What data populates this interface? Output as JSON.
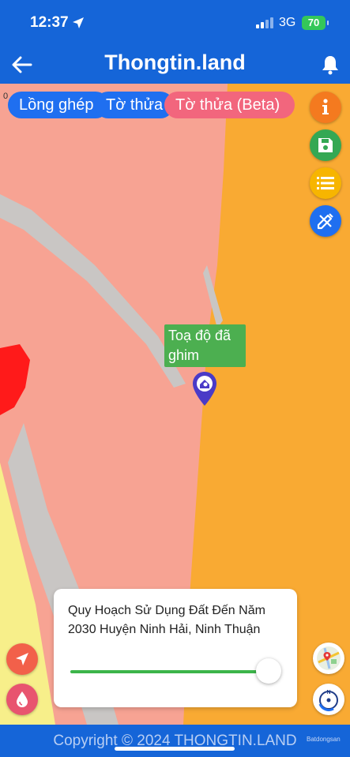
{
  "status_bar": {
    "time": "12:37",
    "network": "3G",
    "battery": "70"
  },
  "app_bar": {
    "title": "Thongtin.land"
  },
  "map": {
    "corner_label": "0",
    "chips": [
      "Lồng ghép",
      "Tờ thửa",
      "Tờ thửa (Beta)"
    ],
    "pin_label": "Toạ độ đã ghim",
    "colors": {
      "residential": "#f7a393",
      "agricultural": "#f9aa33",
      "road": "#c9c6c4",
      "red_zone": "#ff1a1a",
      "yellow_zone": "#f7ef8a"
    }
  },
  "side_buttons": {
    "info": "info-icon",
    "save": "save-icon",
    "list": "list-icon",
    "edit": "pencil-ruler-icon"
  },
  "panel": {
    "title": "Quy Hoạch Sử Dụng Đất Đến Năm 2030 Huyện Ninh Hải, Ninh Thuận",
    "opacity": 1.0
  },
  "footer": {
    "copyright": "Copyright © 2024 THONGTIN.LAND",
    "watermark": "Batdongsan"
  }
}
